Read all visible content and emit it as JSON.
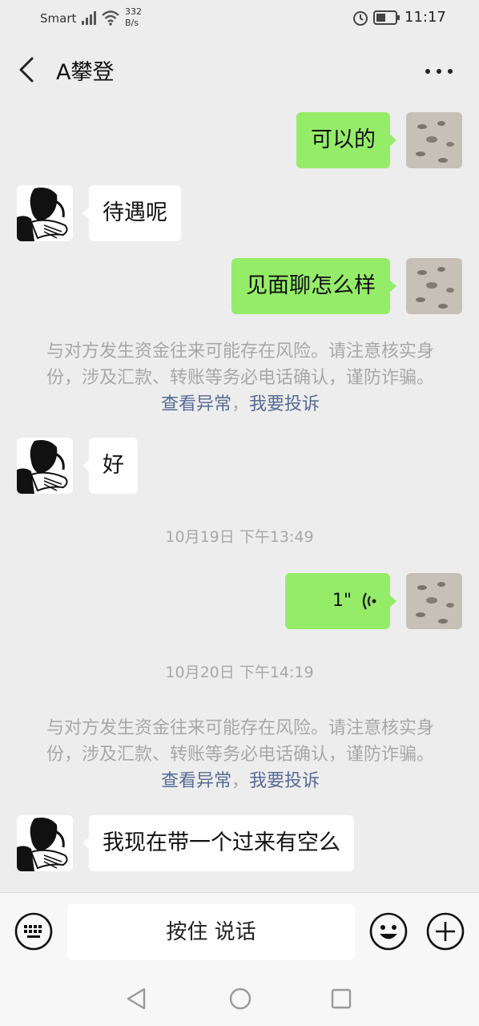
{
  "status_bar": {
    "carrier": "Smart",
    "speed_value": "332",
    "speed_unit": "B/s",
    "time": "11:17"
  },
  "header": {
    "title": "A攀登",
    "back_icon": "chevron-left-icon",
    "more_icon": "more-dots-icon"
  },
  "messages": {
    "m1": {
      "sender": "self",
      "text": "可以的"
    },
    "m2": {
      "sender": "other",
      "text": "待遇呢"
    },
    "m3": {
      "sender": "self",
      "text": "见面聊怎么样"
    },
    "warning1": {
      "text": "与对方发生资金往来可能存在风险。请注意核实身份，涉及汇款、转账等务必电话确认，谨防诈骗。",
      "link1": "查看异常",
      "sep": "，",
      "link2": "我要投诉"
    },
    "m4": {
      "sender": "other",
      "text": "好"
    },
    "time1": "10月19日 下午13:49",
    "m5": {
      "sender": "self",
      "type": "voice",
      "duration": "1\""
    },
    "time2": "10月20日 下午14:19",
    "warning2": {
      "text": "与对方发生资金往来可能存在风险。请注意核实身份，涉及汇款、转账等务必电话确认，谨防诈骗。",
      "link1": "查看异常",
      "sep": "，",
      "link2": "我要投诉"
    },
    "m6": {
      "sender": "other",
      "text": "我现在带一个过来有空么"
    }
  },
  "input_bar": {
    "talk_label": "按住 说话",
    "keyboard_icon": "keyboard-icon",
    "emoji_icon": "emoji-icon",
    "plus_icon": "plus-icon"
  },
  "colors": {
    "self_bubble": "#95ec69",
    "other_bubble": "#ffffff",
    "background": "#ededed",
    "link": "#576b95"
  }
}
